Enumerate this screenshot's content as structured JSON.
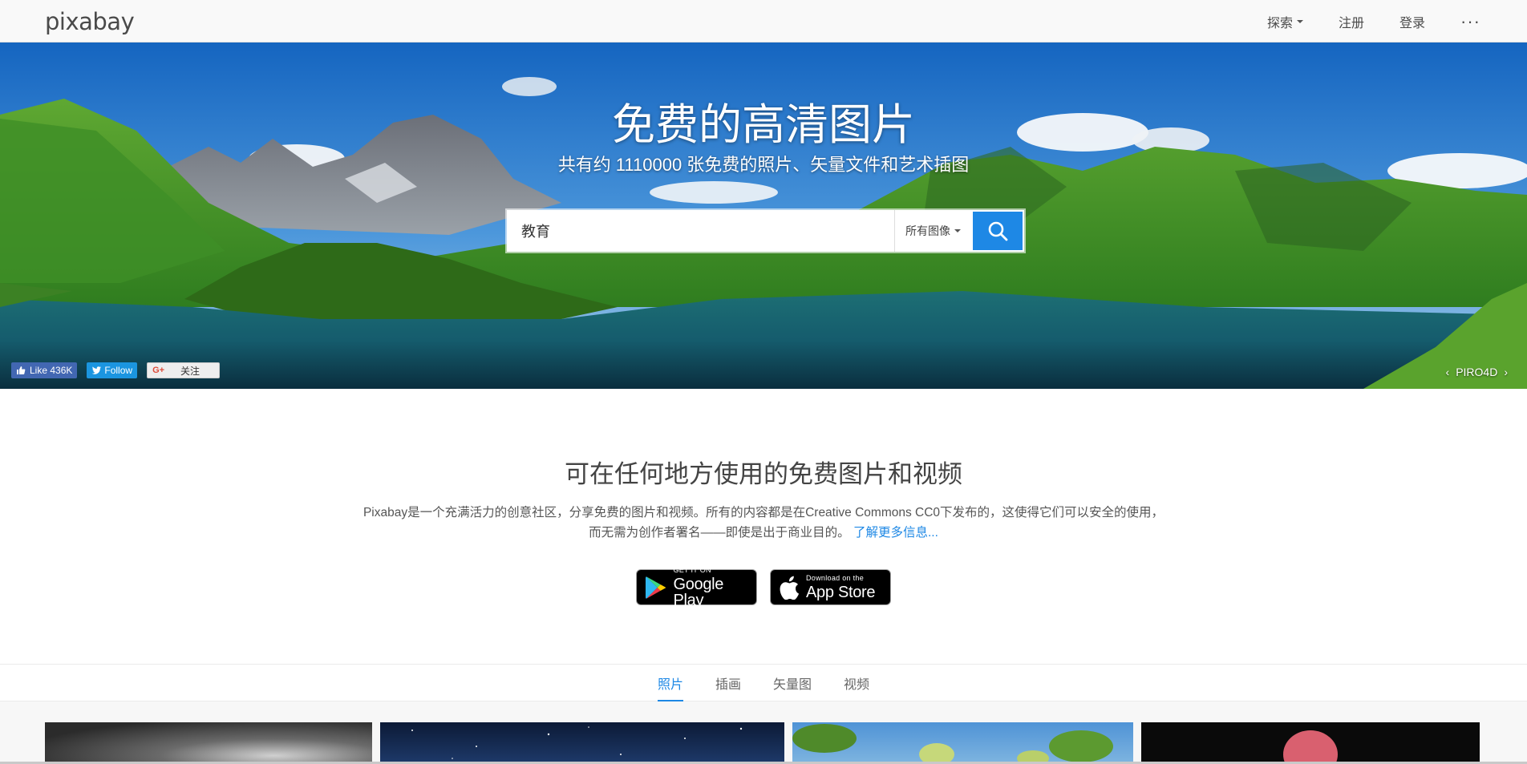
{
  "header": {
    "logo": "pixabay",
    "nav": [
      {
        "label": "探索",
        "dropdown": true
      },
      {
        "label": "注册",
        "dropdown": false
      },
      {
        "label": "登录",
        "dropdown": false
      },
      {
        "label": "···",
        "dropdown": false
      }
    ]
  },
  "hero": {
    "title": "免费的高清图片",
    "subtitle": "共有约 1110000 张免费的照片、矢量文件和艺术插图",
    "search": {
      "value": "教育",
      "type_label": "所有图像"
    },
    "social": {
      "facebook": "Like 436K",
      "twitter": "Follow",
      "google": "关注"
    },
    "credit": "PIRO4D",
    "credit_prev": "‹",
    "credit_next": "›"
  },
  "intro": {
    "title": "可在任何地方使用的免费图片和视频",
    "text": "Pixabay是一个充满活力的创意社区，分享免费的图片和视频。所有的内容都是在Creative Commons CC0下发布的，这使得它们可以安全的使用，而无需为创作者署名——即使是出于商业目的。",
    "link": "了解更多信息..."
  },
  "stores": {
    "google_small": "GET IT ON",
    "google_big": "Google Play",
    "apple_small": "Download on the",
    "apple_big": "App Store"
  },
  "tabs": [
    {
      "label": "照片",
      "active": true
    },
    {
      "label": "插画",
      "active": false
    },
    {
      "label": "矢量图",
      "active": false
    },
    {
      "label": "视频",
      "active": false
    }
  ],
  "colors": {
    "accent": "#1e88e5",
    "topbar_bg": "#f9f9f9"
  }
}
